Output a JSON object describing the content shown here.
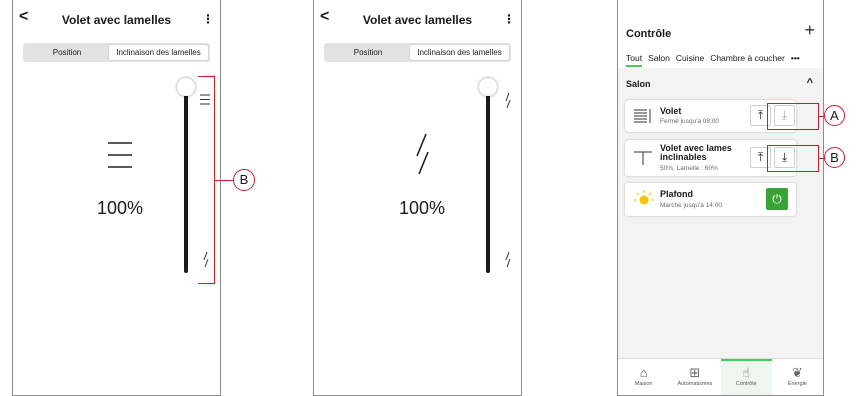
{
  "screen_left": {
    "title": "Volet avec lamelles",
    "tabs": [
      "Position",
      "Inclinaison des lamelles"
    ],
    "active_tab": "Inclinaison des lamelles",
    "value": "100%",
    "callout": "B"
  },
  "screen_middle": {
    "title": "Volet avec lamelles",
    "tabs": [
      "Position",
      "Inclinaison des lamelles"
    ],
    "active_tab": "Inclinaison des lamelles",
    "value": "100%"
  },
  "screen_right": {
    "title": "Contrôle",
    "tabs": [
      "Tout",
      "Salon",
      "Cuisine",
      "Chambre à coucher"
    ],
    "more": "•••",
    "section": "Salon",
    "devices": [
      {
        "name": "Volet",
        "status": "Fermé jusqu'à 08:00",
        "callout": "A"
      },
      {
        "name": "Volet avec lames inclinables",
        "status": "50%, Lamelle : 60%",
        "callout": "B"
      },
      {
        "name": "Plafond",
        "status": "Marche jusqu'à 14:00"
      }
    ],
    "nav": [
      "Maison",
      "Automatismes",
      "Contrôle",
      "Énergie"
    ],
    "active_nav": "Contrôle"
  },
  "colors": {
    "accent": "#3dcd58",
    "power": "#3aa335",
    "callout": "#c8202e"
  },
  "slider_level": 1.0
}
